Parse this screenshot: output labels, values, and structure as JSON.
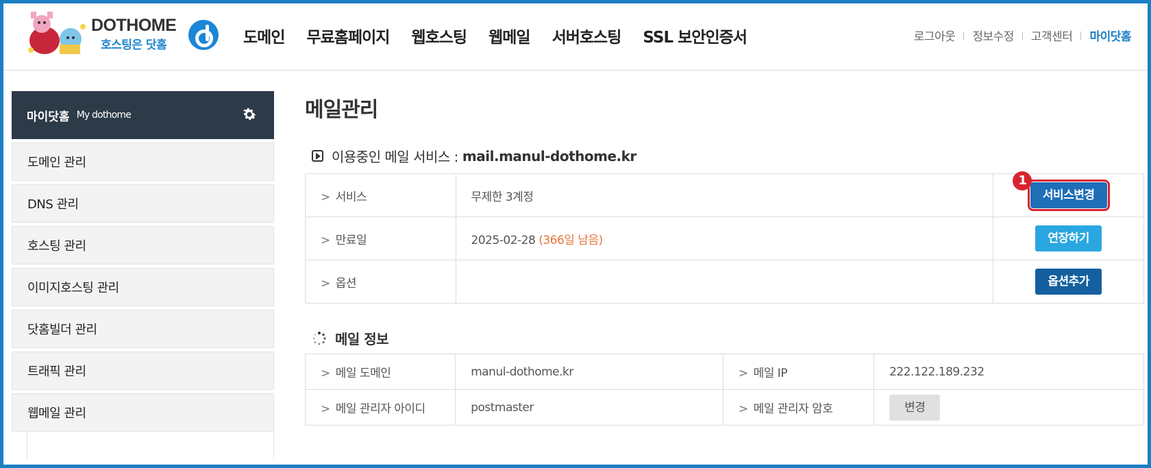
{
  "header": {
    "logo_text": "DOTHOME",
    "logo_sub": "호스팅은 닷홈",
    "nav": [
      "도메인",
      "무료홈페이지",
      "웹호스팅",
      "웹메일",
      "서버호스팅",
      "SSL 보안인증서"
    ],
    "util": [
      "로그아웃",
      "정보수정",
      "고객센터",
      "마이닷홈"
    ]
  },
  "sidebar": {
    "title": "마이닷홈",
    "subtitle": "My dothome",
    "items": [
      "도메인 관리",
      "DNS 관리",
      "호스팅 관리",
      "이미지호스팅 관리",
      "닷홈빌더 관리",
      "트래픽 관리",
      "웹메일 관리"
    ]
  },
  "main": {
    "page_title": "메일관리",
    "service_section": {
      "title": "이용중인 메일 서비스 :",
      "domain": "mail.manul-dothome.kr",
      "rows": [
        {
          "label": "서비스",
          "value": "무제한 3계정",
          "button": "서비스변경"
        },
        {
          "label": "만료일",
          "value": "2025-02-28",
          "remain": "(366일 남음)",
          "button": "연장하기"
        },
        {
          "label": "옵션",
          "value": "",
          "button": "옵션추가"
        }
      ]
    },
    "info_section": {
      "title": "메일 정보",
      "rows": [
        {
          "label": "메일 도메인",
          "value": "manul-dothome.kr",
          "label2": "메일 IP",
          "value2": "222.122.189.232"
        },
        {
          "label": "메일 관리자 아이디",
          "value": "postmaster",
          "label2": "메일 관리자 암호",
          "button": "변경"
        }
      ]
    },
    "annotation_badge": "1"
  },
  "colors": {
    "accent": "#1b7fc4",
    "sidebar_header": "#2d3a48",
    "remain_orange": "#e8743b",
    "highlight_red": "#d82430"
  }
}
